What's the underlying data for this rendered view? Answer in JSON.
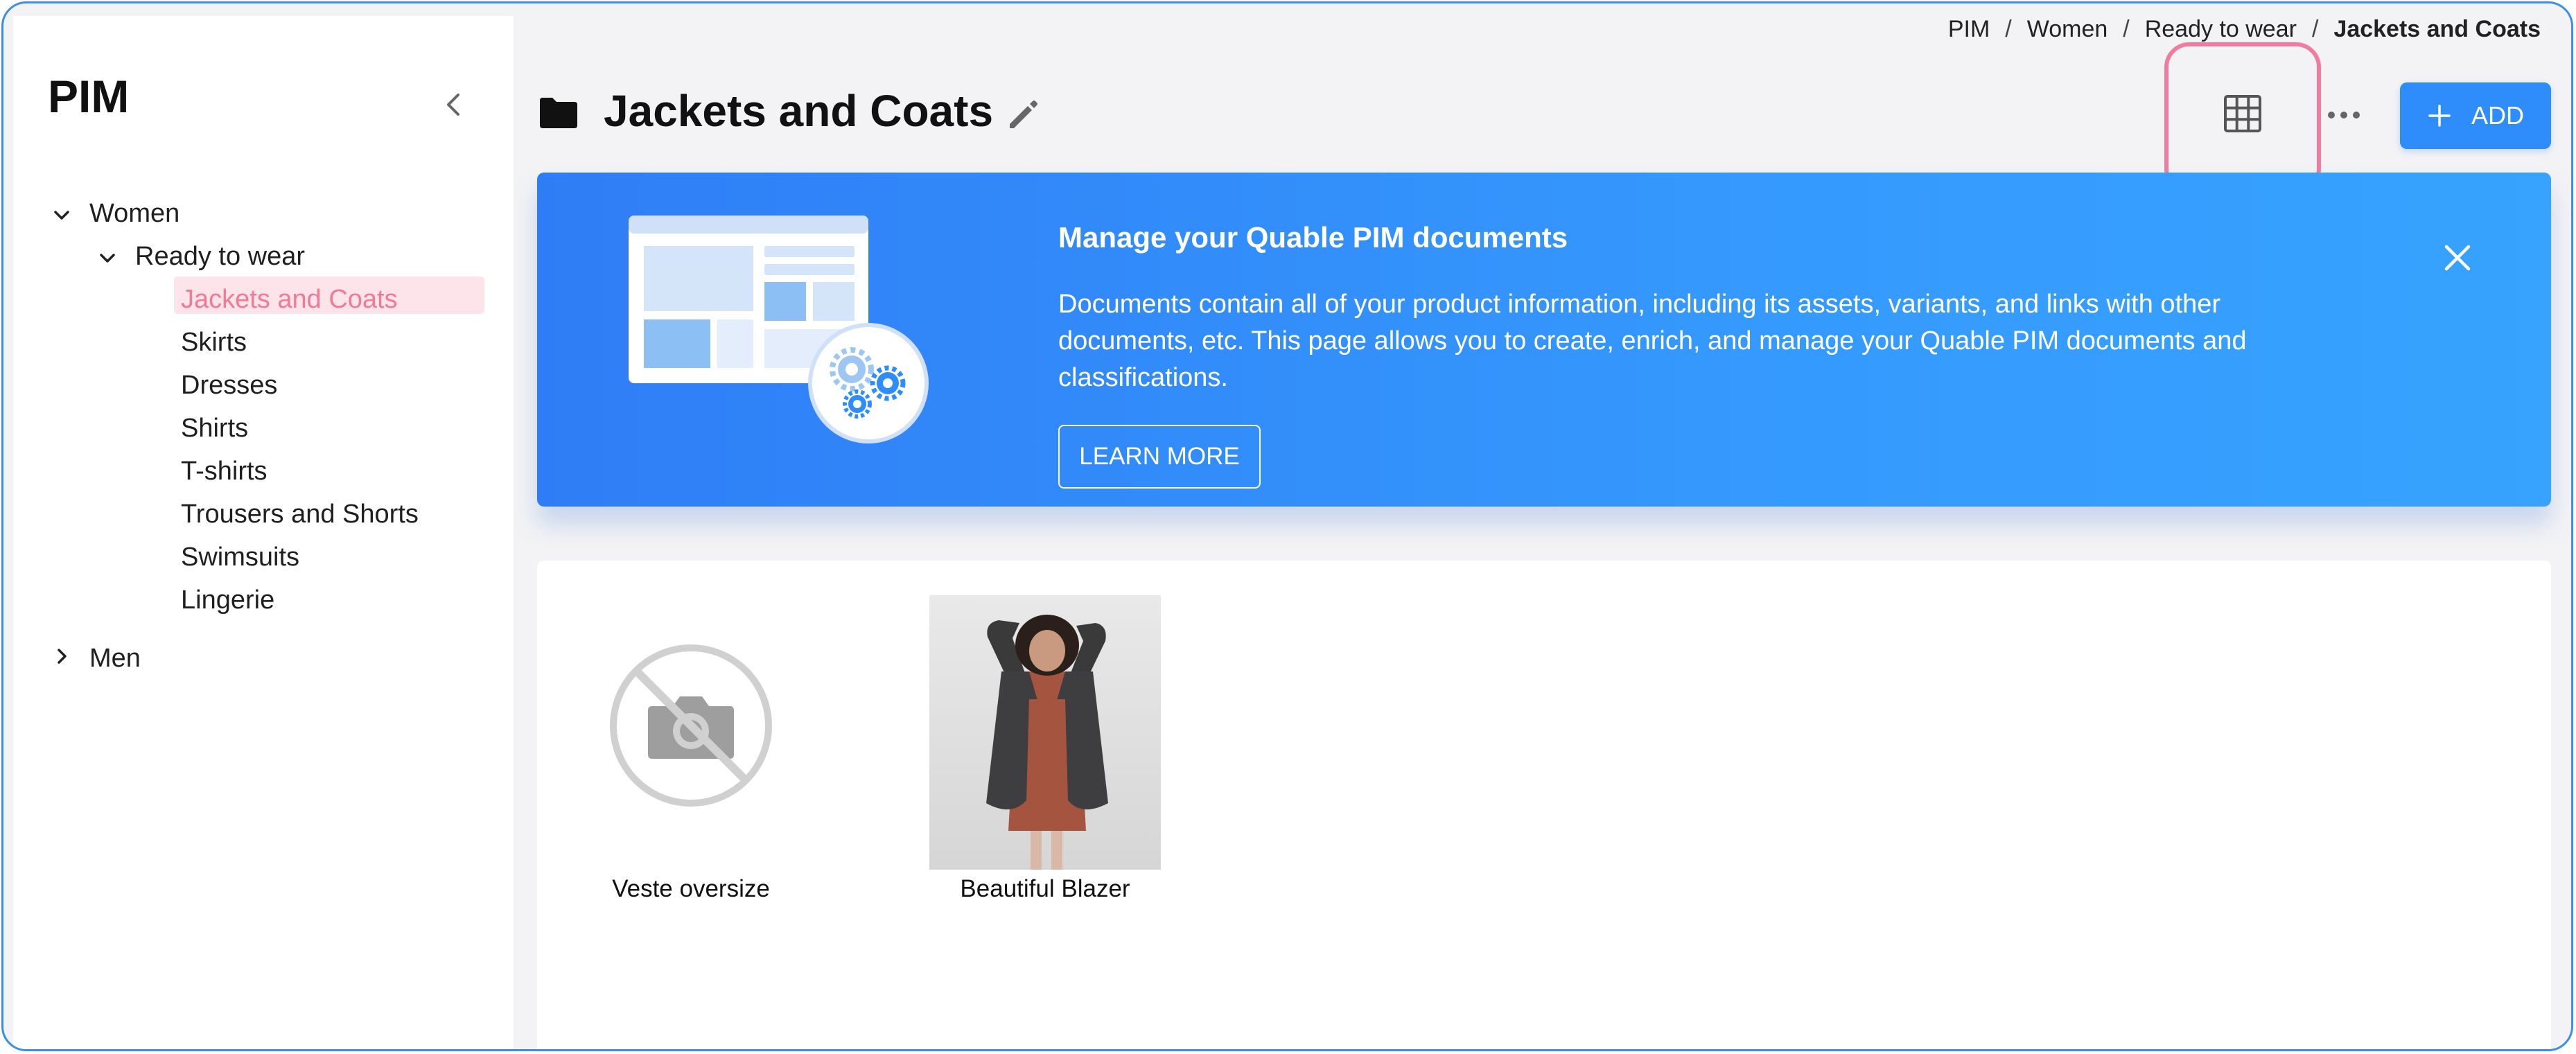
{
  "sidebar": {
    "title": "PIM",
    "tree": {
      "women": {
        "label": "Women",
        "ready_to_wear": {
          "label": "Ready to wear",
          "items": [
            {
              "label": "Jackets and Coats",
              "selected": true
            },
            {
              "label": "Skirts"
            },
            {
              "label": "Dresses"
            },
            {
              "label": "Shirts"
            },
            {
              "label": "T-shirts"
            },
            {
              "label": "Trousers and Shorts"
            },
            {
              "label": "Swimsuits"
            },
            {
              "label": "Lingerie"
            }
          ]
        }
      },
      "men": {
        "label": "Men"
      }
    }
  },
  "breadcrumb": [
    "PIM",
    "Women",
    "Ready to wear",
    "Jackets and Coats"
  ],
  "breadcrumb_separator": "/",
  "header": {
    "title": "Jackets and Coats",
    "add_label": "ADD"
  },
  "banner": {
    "title": "Manage your Quable PIM documents",
    "text": "Documents contain all of your product information, including its assets, variants, and links with other documents, etc. This page allows you to create, enrich, and manage your Quable PIM documents and classifications.",
    "button_label": "LEARN MORE"
  },
  "documents": [
    {
      "name": "Veste oversize",
      "image": "no-image-icon"
    },
    {
      "name": "Beautiful Blazer",
      "image": "model-wearing-blazer-photo"
    }
  ],
  "colors": {
    "accent": "#2f8dfb",
    "selected_text": "#ef7b97",
    "selected_bg": "#fde4ea",
    "highlight": "#f07ca0"
  }
}
